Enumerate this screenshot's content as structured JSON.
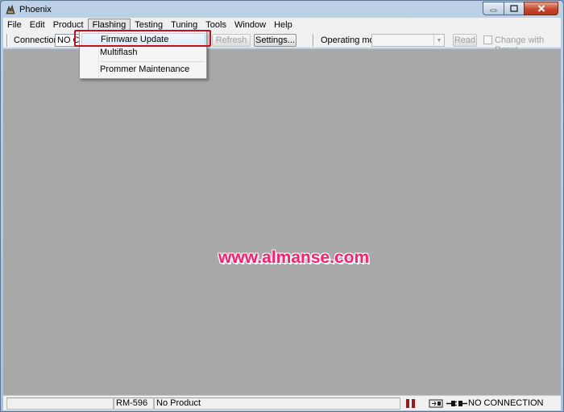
{
  "window": {
    "title": "Phoenix"
  },
  "menubar": {
    "items": [
      {
        "label": "File"
      },
      {
        "label": "Edit"
      },
      {
        "label": "Product"
      },
      {
        "label": "Flashing"
      },
      {
        "label": "Testing"
      },
      {
        "label": "Tuning"
      },
      {
        "label": "Tools"
      },
      {
        "label": "Window"
      },
      {
        "label": "Help"
      }
    ]
  },
  "toolbar": {
    "connections_label": "Connections:",
    "connections_value": "NO CON",
    "refresh_label": "Refresh",
    "settings_label": "Settings...",
    "operating_mode_label": "Operating mode:",
    "operating_mode_value": "",
    "read_label": "Read",
    "change_with_reset_label": "Change with Reset"
  },
  "flashing_menu": {
    "items": [
      {
        "label": "Firmware Update"
      },
      {
        "label": "Multiflash"
      },
      {
        "label": "Prommer Maintenance"
      }
    ]
  },
  "watermark": {
    "text": "www.almanse.com"
  },
  "statusbar": {
    "product_code": "RM-596",
    "product_name": "No Product",
    "connection_status": "NO CONNECTION"
  },
  "colors": {
    "workspace": "#a8a8a8",
    "watermark": "#ff1d6c",
    "highlight_box": "#c2101c"
  }
}
